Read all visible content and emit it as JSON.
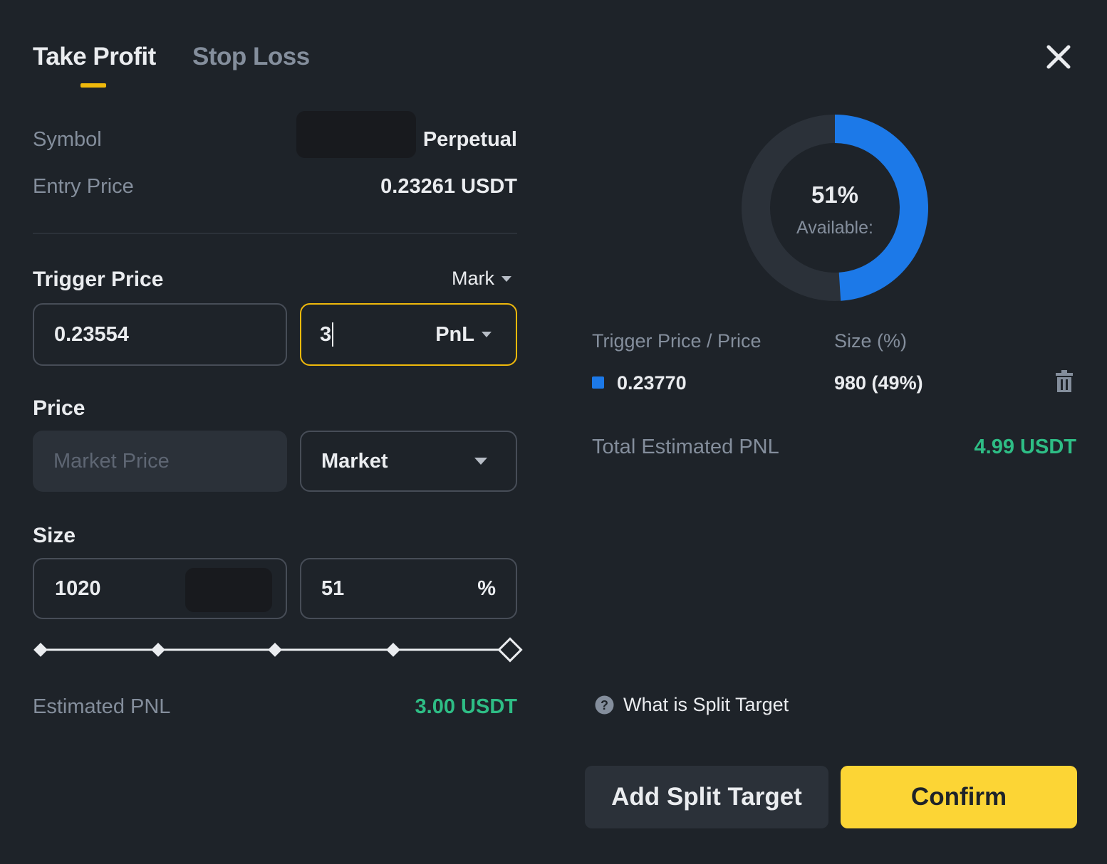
{
  "tabs": {
    "take_profit": "Take Profit",
    "stop_loss": "Stop Loss",
    "active": "Take Profit"
  },
  "symbol": {
    "label": "Symbol",
    "value": "Perpetual"
  },
  "entry_price": {
    "label": "Entry Price",
    "value": "0.23261 USDT"
  },
  "trigger_price": {
    "title": "Trigger Price",
    "type_select": "Mark",
    "price_value": "0.23554",
    "pnl_value": "3",
    "pnl_unit": "PnL"
  },
  "price": {
    "title": "Price",
    "placeholder": "Market Price",
    "order_type": "Market"
  },
  "size": {
    "title": "Size",
    "amount": "1020",
    "percent": "51",
    "percent_unit": "%",
    "slider_fraction": 1.0
  },
  "estimated_pnl": {
    "label": "Estimated PNL",
    "value": "3.00 USDT"
  },
  "donut": {
    "percent_label": "51%",
    "caption": "Available:",
    "blue_fraction": 0.49
  },
  "split_table": {
    "headers": {
      "trigger": "Trigger Price / Price",
      "size": "Size (%)"
    },
    "rows": [
      {
        "price": "0.23770",
        "size": "980 (49%)"
      }
    ]
  },
  "total_pnl": {
    "label": "Total Estimated PNL",
    "value": "4.99 USDT"
  },
  "help_link": "What is Split Target",
  "buttons": {
    "add_split": "Add Split Target",
    "confirm": "Confirm"
  },
  "colors": {
    "accent": "#f0b90b",
    "confirm_bg": "#fcd535",
    "profit_green": "#2ebd85",
    "series_blue": "#1c79e8",
    "background": "#1e2329"
  },
  "icons": {
    "close": "close-icon",
    "delete": "trash-icon",
    "help": "question-circle-icon",
    "dropdown": "chevron-down-icon"
  }
}
